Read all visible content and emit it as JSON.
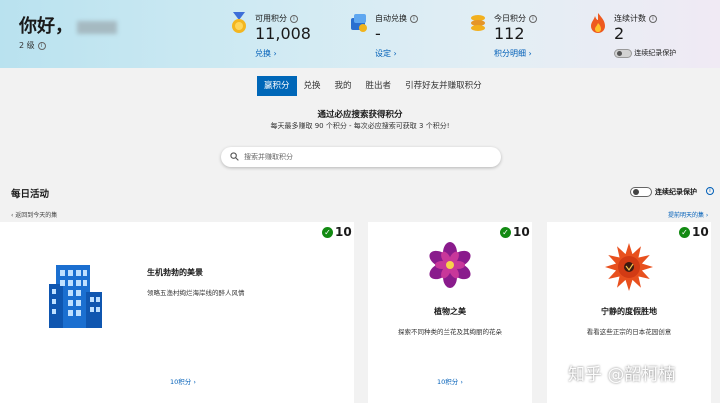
{
  "header": {
    "greeting": "你好，",
    "level": "2 级",
    "stats": [
      {
        "label": "可用积分",
        "value": "11,008",
        "link": "兑换 ›"
      },
      {
        "label": "自动兑换",
        "value": "-",
        "link": "设定 ›"
      },
      {
        "label": "今日积分",
        "value": "112",
        "link": "积分明细 ›"
      },
      {
        "label": "连续计数",
        "value": "2",
        "toggle_label": "连续纪录保护"
      }
    ]
  },
  "tabs": [
    "赢积分",
    "兑换",
    "我的",
    "胜出者",
    "引荐好友并赚取积分"
  ],
  "promo": {
    "title": "通过必应搜索获得积分",
    "subtitle": "每天最多赚取 90 个积分 - 每次必应搜索可获取 3 个积分!"
  },
  "search": {
    "placeholder": "搜索并赚取积分"
  },
  "daily": {
    "title": "每日活动",
    "toggle_label": "连续纪录保护",
    "back_link": "‹ 返回到今天的集",
    "tomorrow_link": "提前明天的集 ›"
  },
  "cards": [
    {
      "points": "10",
      "title": "生机勃勃的美景",
      "desc": "领略五渔村绚烂海岸线的醉人风情",
      "link": "10积分 ›"
    },
    {
      "points": "10",
      "title": "植物之美",
      "desc": "探索不同种类的兰花及其绚丽的花朵",
      "link": "10积分 ›"
    },
    {
      "points": "10",
      "title": "宁静的度假胜地",
      "desc": "看看这些正宗的日本花园创意",
      "link": ""
    }
  ],
  "watermark": "知乎 @韶柯楠",
  "colors": {
    "accent": "#0067b8",
    "link": "#005fb8",
    "check": "#128a12"
  }
}
